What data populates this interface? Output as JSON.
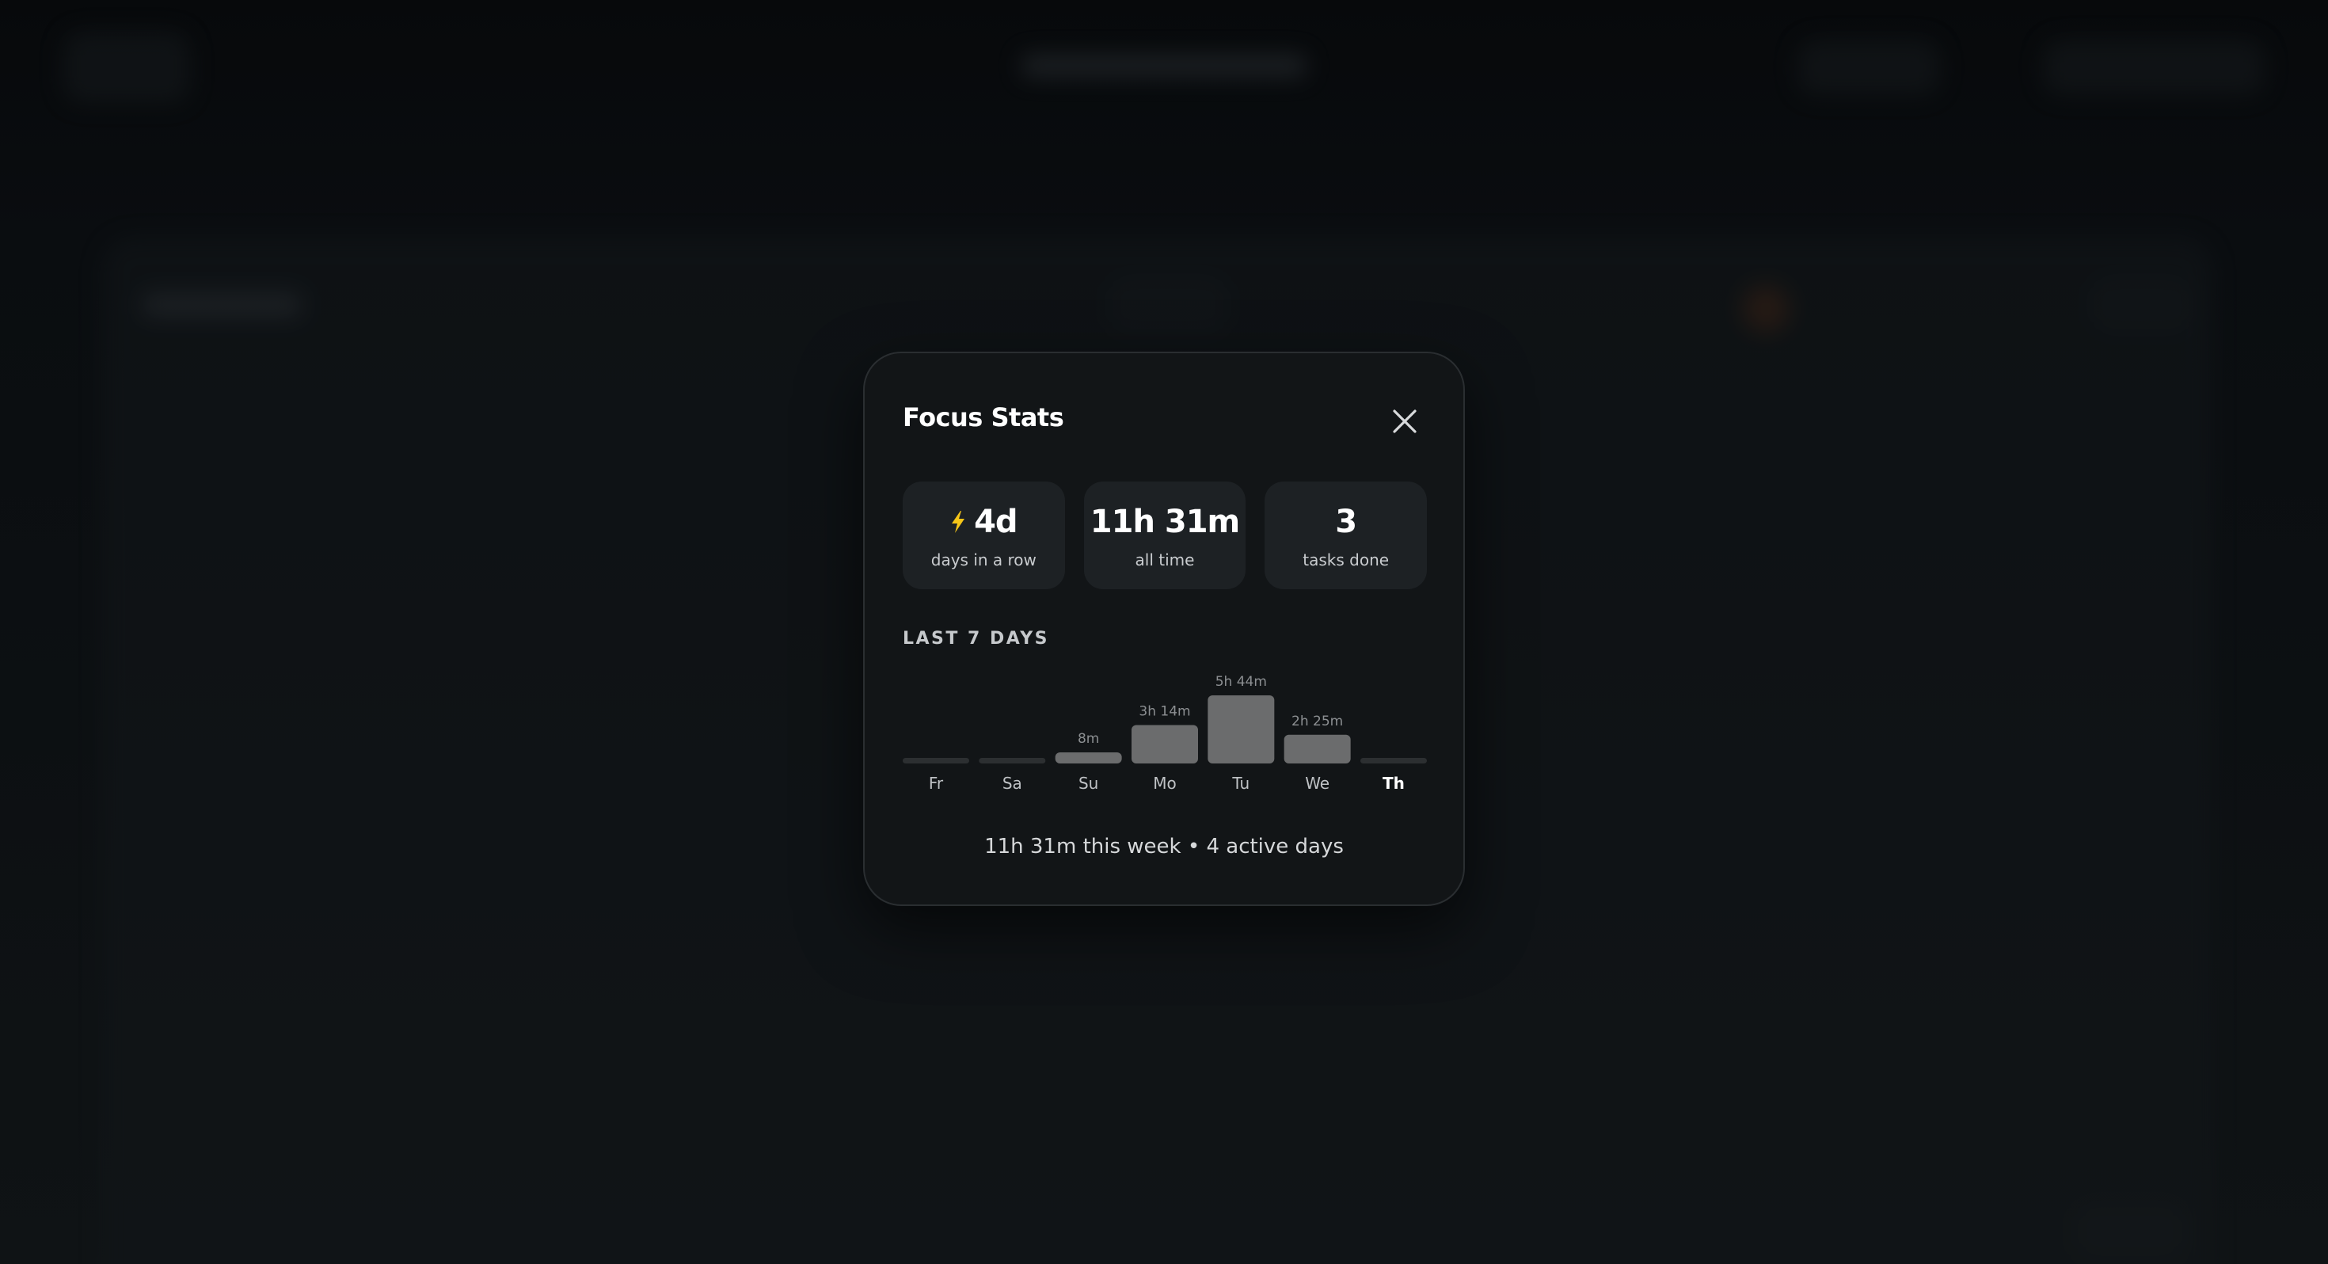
{
  "modal": {
    "title": "Focus Stats",
    "close_icon": "close-icon"
  },
  "stats": [
    {
      "value": "4d",
      "label": "days in a row",
      "icon": "lightning-icon",
      "icon_color": "#f5c518"
    },
    {
      "value": "11h 31m",
      "label": "all time"
    },
    {
      "value": "3",
      "label": "tasks done"
    }
  ],
  "section": {
    "title": "LAST 7 DAYS"
  },
  "chart_data": {
    "type": "bar",
    "categories": [
      "Fr",
      "Sa",
      "Su",
      "Mo",
      "Tu",
      "We",
      "Th"
    ],
    "values_minutes": [
      0,
      0,
      8,
      194,
      344,
      145,
      0
    ],
    "value_labels": [
      "",
      "",
      "8m",
      "3h 14m",
      "5h 44m",
      "2h 25m",
      ""
    ],
    "highlighted_category": "Th",
    "bar_color": "#6b6c6d",
    "empty_bar_color": "#2c2f31"
  },
  "summary": "11h 31m this week • 4 active days"
}
